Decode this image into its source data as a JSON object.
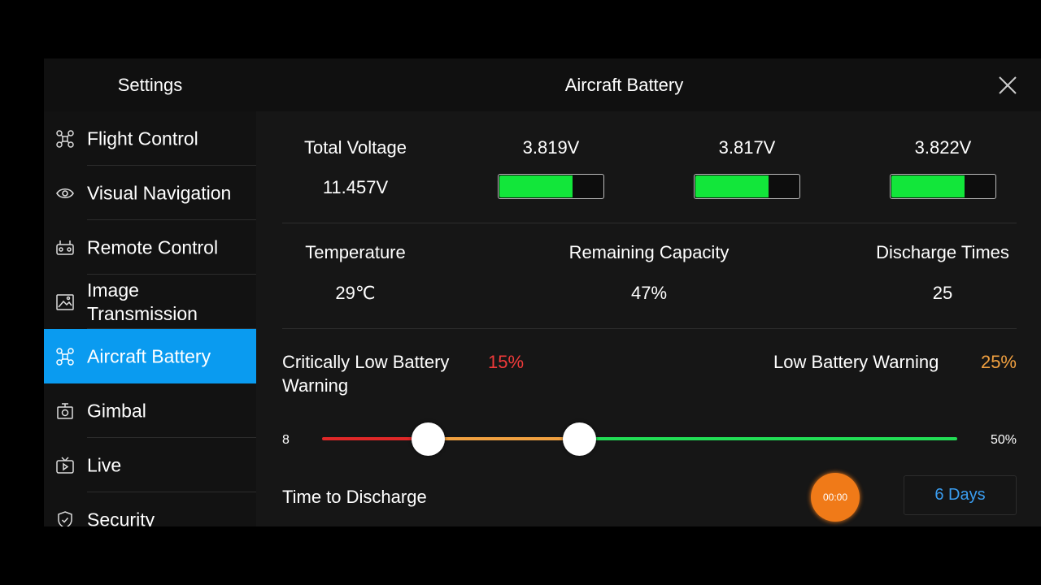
{
  "header": {
    "settings_title": "Settings",
    "page_title": "Aircraft Battery"
  },
  "sidebar": {
    "items": [
      {
        "label": "Flight Control",
        "icon": "drone-icon"
      },
      {
        "label": "Visual Navigation",
        "icon": "eye-icon"
      },
      {
        "label": "Remote Control",
        "icon": "remote-controller-icon"
      },
      {
        "label": "Image Transmission",
        "icon": "image-transmission-icon"
      },
      {
        "label": "Aircraft Battery",
        "icon": "drone-icon",
        "active": true
      },
      {
        "label": "Gimbal",
        "icon": "camera-gimbal-icon"
      },
      {
        "label": "Live",
        "icon": "live-tv-icon"
      },
      {
        "label": "Security",
        "icon": "shield-check-icon"
      }
    ],
    "active_color": "#0a9bf0"
  },
  "voltage": {
    "label": "Total Voltage",
    "total": "11.457V",
    "cells": [
      {
        "value": "3.819V",
        "level": 0.7
      },
      {
        "value": "3.817V",
        "level": 0.7
      },
      {
        "value": "3.822V",
        "level": 0.7
      }
    ],
    "cell_color": "#12e63a"
  },
  "stats": {
    "temperature_label": "Temperature",
    "temperature_value": "29℃",
    "capacity_label": "Remaining Capacity",
    "capacity_value": "47%",
    "discharge_label": "Discharge Times",
    "discharge_value": "25"
  },
  "warnings": {
    "critical_label": "Critically Low Battery Warning",
    "critical_value": "15%",
    "low_label": "Low Battery Warning",
    "low_value": "25%",
    "critical_color": "#f03a3a",
    "low_color": "#f0a040"
  },
  "slider": {
    "min_label": "8",
    "max_label": "50%",
    "critical_level": 15,
    "low_level": 25,
    "min": 8,
    "max": 50,
    "colors": [
      "#e02828",
      "#f0a040",
      "#22dd55"
    ]
  },
  "discharge": {
    "label": "Time to Discharge",
    "timer": "00:00",
    "days_button": "6 Days"
  }
}
